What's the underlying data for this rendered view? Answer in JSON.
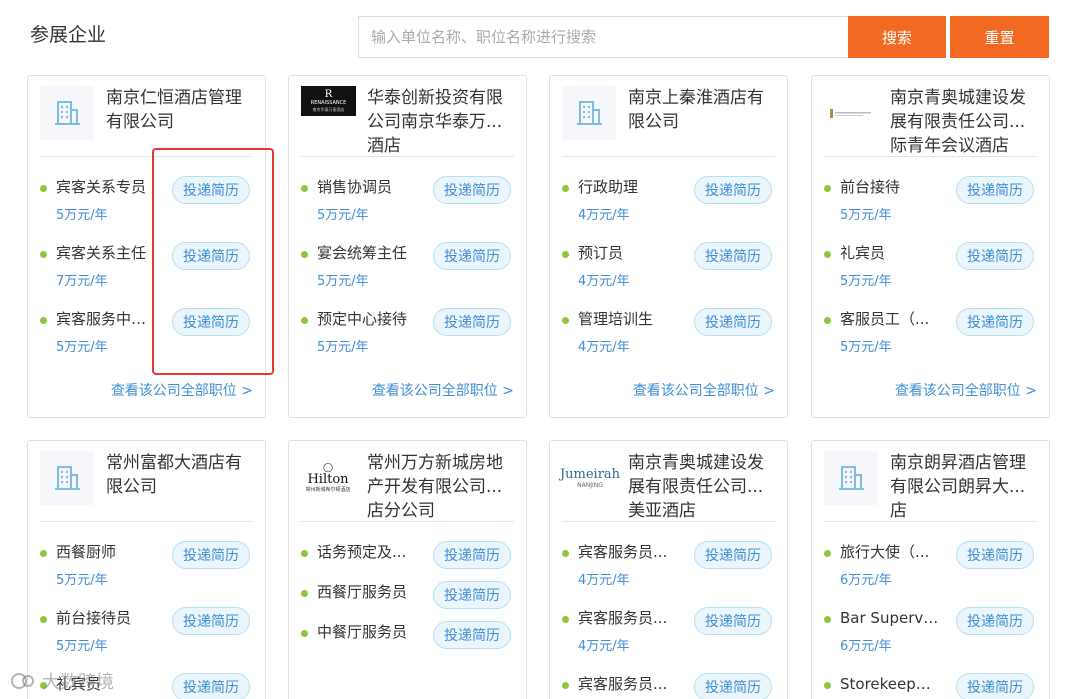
{
  "header": {
    "title": "参展企业",
    "search_placeholder": "输入单位名称、职位名称进行搜索",
    "search_label": "搜索",
    "reset_label": "重置"
  },
  "apply_label": "投递简历",
  "view_all_label": "查看该公司全部职位 >",
  "logos": {
    "renaissance": "RENAISSANCE",
    "renaissance_sub": "南京华泰万丽酒店",
    "hilton": "Hilton",
    "hilton_sub": "常州新城希尔顿酒店",
    "jumeirah": "Jumeirah",
    "jumeirah_sub": "NANJING"
  },
  "companies": [
    {
      "name": "南京仁恒酒店管理有限公司",
      "logo": "building-icon",
      "jobs": [
        {
          "title": "宾客关系专员",
          "salary": "5万元/年"
        },
        {
          "title": "宾客关系主任",
          "salary": "7万元/年"
        },
        {
          "title": "宾客服务中心...",
          "salary": "5万元/年"
        }
      ]
    },
    {
      "name": "华泰创新投资有限公司南京华泰万...酒店",
      "logo": "renaissance-logo",
      "jobs": [
        {
          "title": "销售协调员",
          "salary": "5万元/年"
        },
        {
          "title": "宴会统筹主任",
          "salary": "5万元/年"
        },
        {
          "title": "预定中心接待",
          "salary": "5万元/年"
        }
      ]
    },
    {
      "name": "南京上秦淮酒店有限公司",
      "logo": "building-icon",
      "jobs": [
        {
          "title": "行政助理",
          "salary": "4万元/年"
        },
        {
          "title": "预订员",
          "salary": "4万元/年"
        },
        {
          "title": "管理培训生",
          "salary": "4万元/年"
        }
      ]
    },
    {
      "name": "南京青奥城建设发展有限责任公司...际青年会议酒店",
      "logo": "small-logo",
      "jobs": [
        {
          "title": "前台接待",
          "salary": "5万元/年"
        },
        {
          "title": "礼宾员",
          "salary": "5万元/年"
        },
        {
          "title": "客服员工（...",
          "salary": "5万元/年"
        }
      ]
    },
    {
      "name": "常州富都大酒店有限公司",
      "logo": "building-icon",
      "jobs": [
        {
          "title": "西餐厨师",
          "salary": "5万元/年"
        },
        {
          "title": "前台接待员",
          "salary": "5万元/年"
        },
        {
          "title": "礼宾员",
          "salary": ""
        }
      ]
    },
    {
      "name": "常州万方新城房地产开发有限公司...店分公司",
      "logo": "hilton-logo",
      "jobs": [
        {
          "title": "话务预定及...",
          "salary": ""
        },
        {
          "title": "西餐厅服务员",
          "salary": ""
        },
        {
          "title": "中餐厅服务员",
          "salary": ""
        }
      ]
    },
    {
      "name": "南京青奥城建设发展有限责任公司...美亚酒店",
      "logo": "jumeirah-logo",
      "jobs": [
        {
          "title": "宾客服务员...",
          "salary": "4万元/年"
        },
        {
          "title": "宾客服务员...",
          "salary": "4万元/年"
        },
        {
          "title": "宾客服务员...",
          "salary": ""
        }
      ]
    },
    {
      "name": "南京朗昇酒店管理有限公司朗昇大...店",
      "logo": "building-icon",
      "jobs": [
        {
          "title": "旅行大使（...",
          "salary": "6万元/年"
        },
        {
          "title": "Bar Supervi...",
          "salary": "6万元/年"
        },
        {
          "title": "Storekeeper ...",
          "salary": ""
        }
      ]
    }
  ],
  "watermark": "大数跨境",
  "colors": {
    "accent": "#f26a22",
    "link": "#3f8ed6",
    "dot": "#8cc63f",
    "highlight": "#e53935"
  }
}
